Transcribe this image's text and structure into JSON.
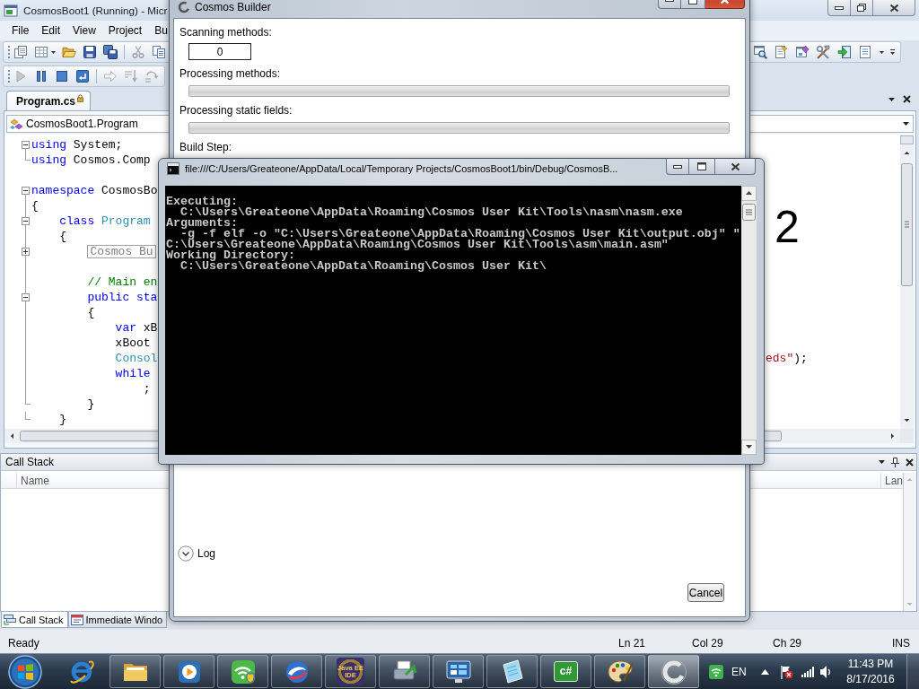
{
  "vs_window": {
    "title": "CosmosBoot1 (Running) - Micr",
    "menu": [
      "File",
      "Edit",
      "View",
      "Project",
      "Bu"
    ],
    "standard_toolbar": {
      "left": [
        {
          "disabled": false
        },
        {
          "disabled": false
        },
        {
          "disabled": false
        },
        {
          "disabled": false
        },
        {
          "disabled": false
        },
        {
          "disabled": true
        },
        {
          "disabled": false
        }
      ],
      "right": [
        {
          "disabled": false
        },
        {
          "disabled": false
        },
        {
          "disabled": false
        },
        {
          "disabled": false
        },
        {
          "disabled": false
        },
        {
          "disabled": false
        }
      ]
    },
    "debug_toolbar": [
      {
        "disabled": true
      },
      {
        "disabled": false
      },
      {
        "disabled": false
      },
      {
        "disabled": false
      },
      {
        "disabled": true
      },
      {
        "disabled": true
      },
      {
        "disabled": true
      }
    ],
    "document_tabs": [
      {
        "label": "Program.cs",
        "selected": true,
        "locked": true
      }
    ],
    "navigation": {
      "type": "CosmosBoot1.Program"
    },
    "code_lines": [
      {
        "expanded": true,
        "tokens": [
          {
            "text": "using",
            "kind": "keyword"
          },
          {
            "text": " System;",
            "kind": "plain"
          }
        ]
      },
      {
        "block_end": true,
        "tokens": [
          {
            "text": "using",
            "kind": "keyword"
          },
          {
            "text": " Cosmos.Comp",
            "kind": "plain"
          }
        ]
      },
      {
        "blank": true
      },
      {
        "expanded": true,
        "tokens": [
          {
            "text": "namespace",
            "kind": "keyword"
          },
          {
            "text": " CosmosBo",
            "kind": "plain"
          }
        ]
      },
      {
        "tokens": [
          {
            "text": "{",
            "kind": "plain"
          }
        ]
      },
      {
        "expanded": true,
        "tokens": [
          {
            "text": "    class",
            "kind": "keyword"
          },
          {
            "text": " Program",
            "kind": "type"
          }
        ]
      },
      {
        "tokens": [
          {
            "text": "    {",
            "kind": "plain"
          }
        ]
      },
      {
        "expanded": false,
        "tokens": [
          {
            "text": "        Cosmos Bu",
            "kind": "collapsed"
          }
        ]
      },
      {
        "blank": true
      },
      {
        "tokens": [
          {
            "text": "        // Main en",
            "kind": "comment"
          }
        ]
      },
      {
        "expanded": true,
        "tokens": [
          {
            "text": "        public sta",
            "kind": "keyword"
          }
        ]
      },
      {
        "tokens": [
          {
            "text": "        {",
            "kind": "plain"
          }
        ]
      },
      {
        "tokens": [
          {
            "text": "            var",
            "kind": "keyword"
          },
          {
            "text": " xB",
            "kind": "plain"
          }
        ]
      },
      {
        "tokens": [
          {
            "text": "            xBoot",
            "kind": "plain"
          }
        ]
      },
      {
        "tokens": [
          {
            "text": "            Consol",
            "kind": "type"
          }
        ],
        "tail": [
          {
            "text": "eds\"",
            "kind": "string"
          },
          {
            "text": ");",
            "kind": "plain"
          }
        ]
      },
      {
        "tokens": [
          {
            "text": "            while",
            "kind": "keyword"
          }
        ]
      },
      {
        "tokens": [
          {
            "text": "                ;",
            "kind": "plain"
          }
        ]
      },
      {
        "block_end": true,
        "tokens": [
          {
            "text": "        }",
            "kind": "plain"
          }
        ]
      },
      {
        "block_end": true,
        "tokens": [
          {
            "text": "    }",
            "kind": "plain"
          }
        ]
      }
    ],
    "annotation": "2",
    "call_stack": {
      "title": "Call Stack",
      "columns": [
        "Name",
        "Lan"
      ]
    },
    "panel_tabs": [
      {
        "label": "Call Stack",
        "selected": true
      },
      {
        "label": "Immediate Windo",
        "selected": false
      }
    ],
    "status_bar": {
      "message": "Ready",
      "line": "Ln 21",
      "column": "Col 29",
      "character": "Ch 29",
      "mode": "INS"
    }
  },
  "builder_window": {
    "title": "Cosmos Builder",
    "fields": [
      {
        "label": "Scanning methods:",
        "kind": "counter",
        "value": "0"
      },
      {
        "label": "Processing methods:",
        "kind": "progress",
        "level": 0
      },
      {
        "label": "Processing static fields:",
        "kind": "progress",
        "level": 0
      },
      {
        "label": "Build Step:",
        "kind": "text"
      }
    ],
    "log": {
      "label": "Log",
      "expanded": false
    },
    "cancel_button": "Cancel"
  },
  "console_window": {
    "title": "file:///C:/Users/Greateone/AppData/Local/Temporary Projects/CosmosBoot1/bin/Debug/CosmosB...",
    "lines": [
      "Executing:",
      "  C:\\Users\\Greateone\\AppData\\Roaming\\Cosmos User Kit\\Tools\\nasm\\nasm.exe",
      "Arguments:",
      "  -g -f elf -o \"C:\\Users\\Greateone\\AppData\\Roaming\\Cosmos User Kit\\output.obj\" \"",
      "C:\\Users\\Greateone\\AppData\\Roaming\\Cosmos User Kit\\Tools\\asm\\main.asm\"",
      "Working Directory:",
      "  C:\\Users\\Greateone\\AppData\\Roaming\\Cosmos User Kit\\"
    ]
  },
  "taskbar": {
    "apps": [
      {
        "running": false,
        "active": false
      },
      {
        "running": true,
        "active": false
      },
      {
        "running": true,
        "active": false
      },
      {
        "running": true,
        "active": false
      },
      {
        "running": true,
        "active": false
      },
      {
        "running": true,
        "active": false,
        "label": "Java EE IDE"
      },
      {
        "running": true,
        "active": false
      },
      {
        "running": true,
        "active": false
      },
      {
        "running": true,
        "active": false
      },
      {
        "running": true,
        "active": false,
        "label": "c#"
      },
      {
        "running": true,
        "active": false
      },
      {
        "running": true,
        "active": true
      }
    ],
    "tray": {
      "language": "EN",
      "time": "11:43 PM",
      "date": "8/17/2016"
    }
  }
}
